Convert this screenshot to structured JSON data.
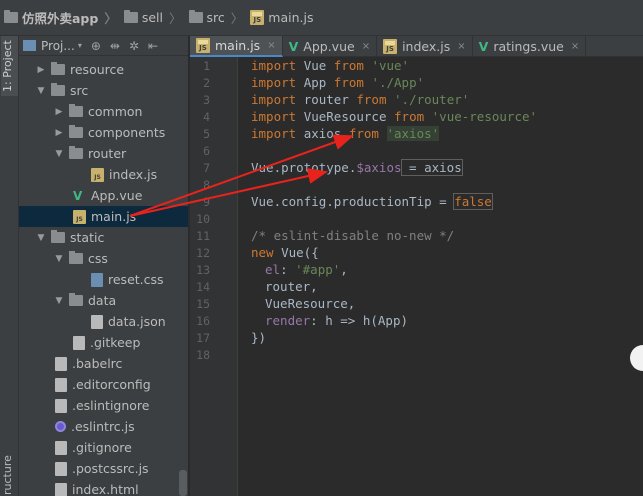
{
  "breadcrumb": [
    {
      "label": "仿照外卖app",
      "icon": "folder-icon"
    },
    {
      "label": "sell",
      "icon": "folder-icon"
    },
    {
      "label": "src",
      "icon": "folder-icon"
    },
    {
      "label": "main.js",
      "icon": "js-file-icon"
    }
  ],
  "toolwindow": {
    "project_tab": "1: Project",
    "structure_tab": "ructure"
  },
  "project_panel": {
    "title": "Proj...",
    "toolbar": {
      "sync": "⊕",
      "collapse": "⇹",
      "settings": "✲",
      "hide": "⇤"
    },
    "items": [
      {
        "label": "resource",
        "type": "folder",
        "arrow": "▶"
      },
      {
        "label": "src",
        "type": "folder",
        "arrow": "▼"
      },
      {
        "label": "common",
        "type": "folder",
        "arrow": "▶"
      },
      {
        "label": "components",
        "type": "folder",
        "arrow": "▶"
      },
      {
        "label": "router",
        "type": "folder",
        "arrow": "▼"
      },
      {
        "label": "index.js",
        "type": "js"
      },
      {
        "label": "App.vue",
        "type": "vue"
      },
      {
        "label": "main.js",
        "type": "js",
        "selected": true
      },
      {
        "label": "static",
        "type": "folder",
        "arrow": "▼"
      },
      {
        "label": "css",
        "type": "folder",
        "arrow": "▼"
      },
      {
        "label": "reset.css",
        "type": "css"
      },
      {
        "label": "data",
        "type": "folder",
        "arrow": "▼"
      },
      {
        "label": "data.json",
        "type": "file"
      },
      {
        "label": ".gitkeep",
        "type": "file"
      },
      {
        "label": ".babelrc",
        "type": "file"
      },
      {
        "label": ".editorconfig",
        "type": "file"
      },
      {
        "label": ".eslintignore",
        "type": "file"
      },
      {
        "label": ".eslintrc.js",
        "type": "eslint"
      },
      {
        "label": ".gitignore",
        "type": "file"
      },
      {
        "label": ".postcssrc.js",
        "type": "file"
      },
      {
        "label": "index.html",
        "type": "file"
      }
    ]
  },
  "tabs": [
    {
      "label": "main.js",
      "icon": "js",
      "active": true,
      "close": "×"
    },
    {
      "label": "App.vue",
      "icon": "vue",
      "close": "×"
    },
    {
      "label": "index.js",
      "icon": "js",
      "close": "×"
    },
    {
      "label": "ratings.vue",
      "icon": "vue",
      "close": "×"
    }
  ],
  "code": {
    "line_numbers": [
      "1",
      "2",
      "3",
      "4",
      "5",
      "6",
      "7",
      "8",
      "9",
      "10",
      "11",
      "12",
      "13",
      "14",
      "15",
      "16",
      "17",
      "18"
    ],
    "l1": {
      "k": "import",
      "a": "Vue",
      "f": "from",
      "s": "'vue'"
    },
    "l2": {
      "k": "import",
      "a": "App",
      "f": "from",
      "s": "'./App'"
    },
    "l3": {
      "k": "import",
      "a": "router",
      "f": "from",
      "s": "'./router'"
    },
    "l4": {
      "k": "import",
      "a": "VueResource",
      "f": "from",
      "s": "'vue-resource'"
    },
    "l5": {
      "k": "import",
      "a": "axios",
      "f": "from",
      "s": "'axios'"
    },
    "l7": {
      "a": "Vue.prototype.",
      "p": "$axios",
      "b": " = axios"
    },
    "l9": {
      "a": "Vue.config.productionTip = ",
      "k": "false"
    },
    "l11": "/* eslint-disable no-new */",
    "l12": {
      "k": "new",
      "a": " Vue({"
    },
    "l13": {
      "p": "el",
      "a": ": ",
      "s": "'#app'",
      "b": ","
    },
    "l14": "router,",
    "l15": "VueResource,",
    "l16": {
      "p": "render",
      "a": ": h => h(App)"
    },
    "l17": "})"
  },
  "colors": {
    "arrow": "#e8231c",
    "keyword": "#cc7832",
    "string": "#6a8759",
    "selection": "#0d293e"
  }
}
